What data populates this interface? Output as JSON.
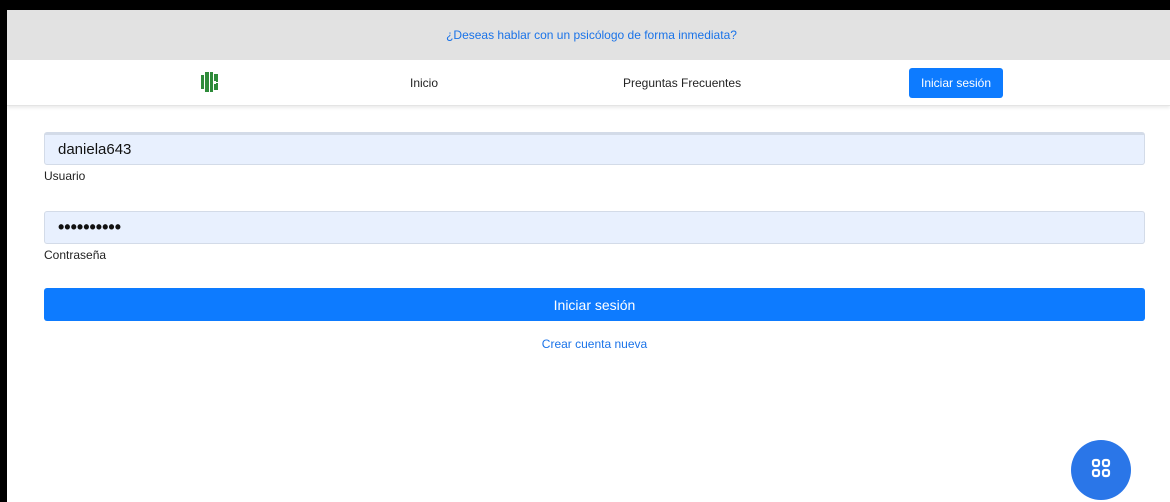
{
  "banner": {
    "text": "¿Deseas hablar con un psicólogo de forma inmediata?"
  },
  "nav": {
    "logo_icon": "uis-logo-icon",
    "logo_color": "#2e8b3a",
    "links": {
      "home": "Inicio",
      "faq": "Preguntas Frecuentes"
    },
    "login_label": "Iniciar sesión"
  },
  "form": {
    "username": {
      "value": "daniela643",
      "label": "Usuario"
    },
    "password": {
      "value": "••••••••••",
      "label": "Contraseña"
    },
    "submit_label": "Iniciar sesión",
    "create_account": "Crear cuenta nueva"
  },
  "fab": {
    "icon": "grid-apps-icon"
  },
  "colors": {
    "primary": "#0d7bff",
    "link": "#1a73e8",
    "banner_bg": "#e2e2e2",
    "input_bg": "#e8f0fe",
    "fab_bg": "#2a76e8"
  }
}
